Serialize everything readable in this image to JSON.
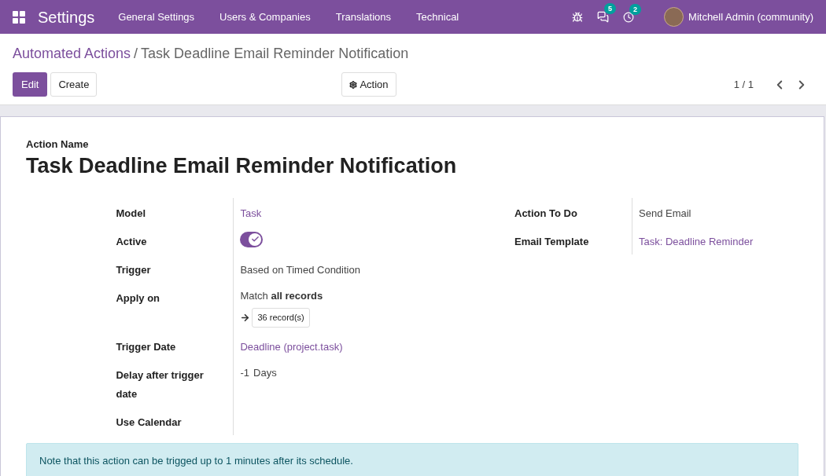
{
  "navbar": {
    "app_title": "Settings",
    "menu": [
      "General Settings",
      "Users & Companies",
      "Translations",
      "Technical"
    ],
    "messages_count": "5",
    "activities_count": "2",
    "user": "Mitchell Admin (community)"
  },
  "breadcrumb": {
    "parent": "Automated Actions",
    "separator": "/",
    "current": "Task Deadline Email Reminder Notification"
  },
  "buttons": {
    "edit": "Edit",
    "create": "Create",
    "action": "Action"
  },
  "pager": "1 / 1",
  "form": {
    "name_label": "Action Name",
    "name": "Task Deadline Email Reminder Notification",
    "left_fields": [
      {
        "kind": "link",
        "label": "Model",
        "value": "Task"
      },
      {
        "kind": "toggle",
        "label": "Active",
        "on": true
      },
      {
        "kind": "text",
        "label": "Trigger",
        "value": "Based on Timed Condition"
      },
      {
        "kind": "domain",
        "label": "Apply on",
        "value": "Match **all records**",
        "records": "36 record(s)"
      },
      {
        "kind": "link",
        "label": "Trigger Date",
        "value": "Deadline (project.task)"
      },
      {
        "kind": "number",
        "label": "Delay after trigger date",
        "value": "-1",
        "unit": "Days"
      },
      {
        "kind": "empty",
        "label": "Use Calendar"
      }
    ],
    "right_fields": [
      {
        "kind": "text",
        "label": "Action To Do",
        "value": "Send Email"
      },
      {
        "kind": "link",
        "label": "Email Template",
        "value": "Task: Deadline Reminder"
      }
    ],
    "note": "Note that this action can be trigged up to 1 minutes after its schedule."
  }
}
